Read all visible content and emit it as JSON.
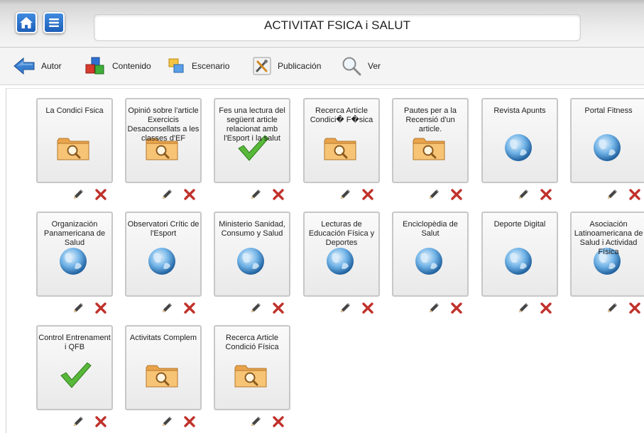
{
  "header": {
    "title": "ACTIVITAT FSICA i SALUT"
  },
  "toolbar": {
    "items": [
      {
        "label": "Autor",
        "icon": "back-arrow-icon"
      },
      {
        "label": "Contenido",
        "icon": "blocks-icon"
      },
      {
        "label": "Escenario",
        "icon": "windows-icon"
      },
      {
        "label": "Publicación",
        "icon": "tools-icon"
      },
      {
        "label": "Ver",
        "icon": "magnifier-icon"
      }
    ]
  },
  "colors": {
    "accent_blue": "#2a73d0",
    "delete_red": "#c0312b",
    "folder_orange": "#e9a44c"
  },
  "resources": [
    {
      "title": "La Condici Fsica",
      "icon": "folder-search-icon"
    },
    {
      "title": "Opinió sobre l'article Exercicis Desaconsellats a les classes d'EF",
      "icon": "folder-search-icon"
    },
    {
      "title": "Fes una lectura del següent article relacionat amb l'Esport i la salut",
      "icon": "checkmark-icon"
    },
    {
      "title": "Recerca Article Condici� F�sica",
      "icon": "folder-search-icon"
    },
    {
      "title": "Pautes per a la Recensió d'un article.",
      "icon": "folder-search-icon"
    },
    {
      "title": "Revista Apunts",
      "icon": "globe-icon"
    },
    {
      "title": "Portal Fitness",
      "icon": "globe-icon"
    },
    {
      "title": "Organización Panamericana de Salud",
      "icon": "globe-icon"
    },
    {
      "title": "Observatori Crític de l'Esport",
      "icon": "globe-icon"
    },
    {
      "title": "Ministerio Sanidad, Consumo y Salud",
      "icon": "globe-icon"
    },
    {
      "title": "Lecturas de Educación Física y Deportes",
      "icon": "globe-icon"
    },
    {
      "title": "Enciclopèdia de Salut",
      "icon": "globe-icon"
    },
    {
      "title": "Deporte Digital",
      "icon": "globe-icon"
    },
    {
      "title": "Asociación Latinoamericana de Salud i Actividad Física",
      "icon": "globe-icon"
    },
    {
      "title": "Control Entrenament i QFB",
      "icon": "checkmark-icon"
    },
    {
      "title": "Activitats Complem",
      "icon": "folder-search-icon"
    },
    {
      "title": "Recerca Article Condició Física",
      "icon": "folder-search-icon"
    }
  ]
}
